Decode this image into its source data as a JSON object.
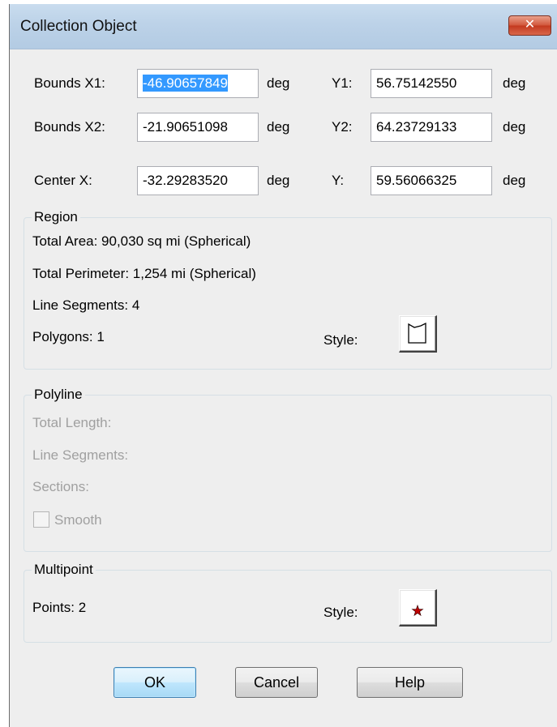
{
  "window": {
    "title": "Collection Object",
    "close_icon": "close-icon"
  },
  "bounds": {
    "x1_label": "Bounds X1:",
    "x1_value": "-46.90657849",
    "x1_unit": "deg",
    "y1_label": "Y1:",
    "y1_value": "56.75142550",
    "y1_unit": "deg",
    "x2_label": "Bounds X2:",
    "x2_value": "-21.90651098",
    "x2_unit": "deg",
    "y2_label": "Y2:",
    "y2_value": "64.23729133",
    "y2_unit": "deg"
  },
  "center": {
    "x_label": "Center X:",
    "x_value": "-32.29283520",
    "x_unit": "deg",
    "y_label": "Y:",
    "y_value": "59.56066325",
    "y_unit": "deg"
  },
  "region": {
    "title": "Region",
    "total_area": "Total Area:  90,030 sq mi (Spherical)",
    "total_perimeter": "Total Perimeter:  1,254 mi (Spherical)",
    "line_segments": "Line Segments:  4",
    "polygons": "Polygons:  1",
    "style_label": "Style:",
    "style_icon": "polygon-style-icon"
  },
  "polyline": {
    "title": "Polyline",
    "total_length": "Total Length:",
    "line_segments": "Line Segments:",
    "sections": "Sections:",
    "smooth_label": "Smooth",
    "smooth_checked": false
  },
  "multipoint": {
    "title": "Multipoint",
    "points": "Points:  2",
    "style_label": "Style:",
    "style_icon": "star-symbol-icon",
    "symbol_color": "#c00000"
  },
  "buttons": {
    "ok": "OK",
    "cancel": "Cancel",
    "help": "Help"
  }
}
